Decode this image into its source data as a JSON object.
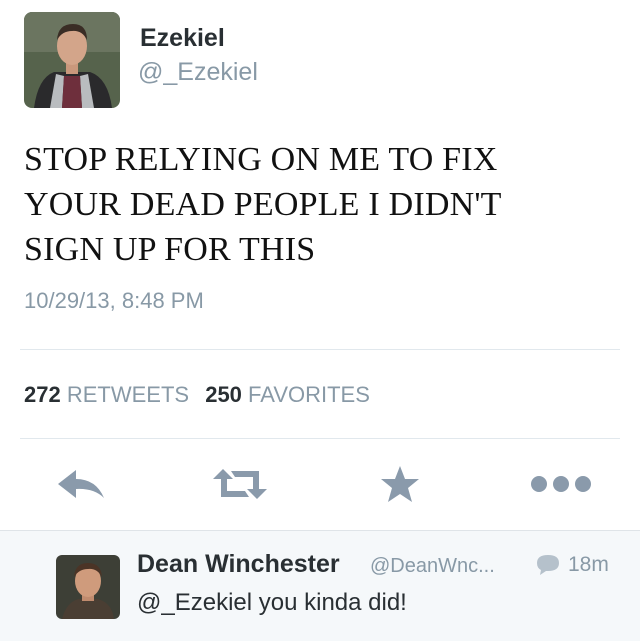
{
  "tweet": {
    "author_name": "Ezekiel",
    "author_handle": "@_Ezekiel",
    "text_lines": [
      "STOP RELYING ON ME TO FIX",
      "YOUR DEAD PEOPLE I DIDN'T",
      "SIGN UP FOR THIS"
    ],
    "timestamp": "10/29/13, 8:48 PM",
    "retweets_count": "272",
    "retweets_label": "RETWEETS",
    "favorites_count": "250",
    "favorites_label": "FAVORITES"
  },
  "actions": {
    "reply_icon": "reply-icon",
    "retweet_icon": "retweet-icon",
    "favorite_icon": "star-icon",
    "more_icon": "more-dots-icon"
  },
  "reply": {
    "author_name": "Dean Winchester",
    "author_handle": "@DeanWnc...",
    "time": "18m",
    "time_icon": "speech-bubble-icon",
    "text": "@_Ezekiel you kinda did!"
  },
  "colors": {
    "muted": "#8899a6",
    "icon": "#8a9aab",
    "text": "#292f33",
    "divider": "#e1e8ed",
    "reply_bg": "#f5f8fa"
  }
}
